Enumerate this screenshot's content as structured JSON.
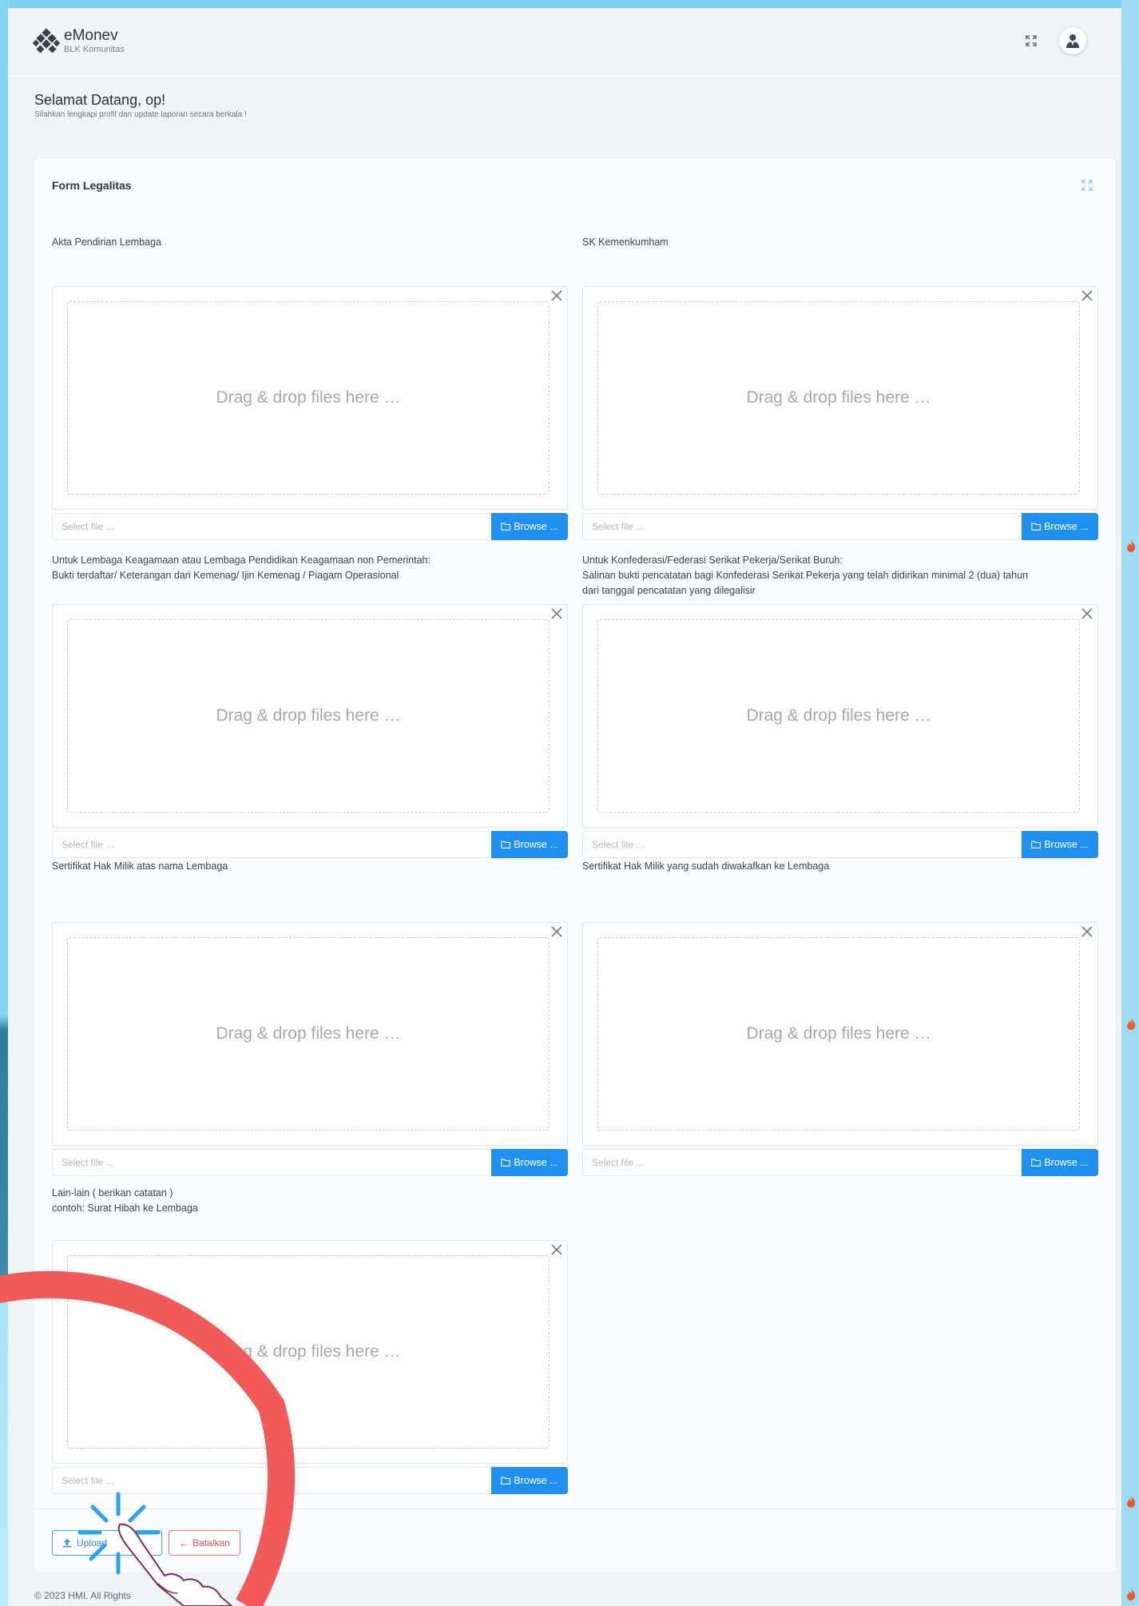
{
  "app": {
    "name": "eMonev",
    "subtitle": "BLK Komunitas"
  },
  "header": {
    "fullscreen_icon": "fullscreen-icon",
    "avatar_icon": "user-avatar-icon"
  },
  "welcome": {
    "title": "Selamat Datang, op!",
    "subtitle": "Silahkan lengkapi profil dan update laporan secara berkala !"
  },
  "form": {
    "title": "Form Legalitas",
    "dropzone_text": "Drag & drop files here …",
    "file_placeholder": "Select file ...",
    "browse_label": "Browse ...",
    "fields": [
      {
        "label_lines": [
          "Akta Pendirian Lembaga"
        ]
      },
      {
        "label_lines": [
          "SK Kemenkumham"
        ]
      },
      {
        "label_lines": [
          "Untuk Lembaga Keagamaan atau Lembaga Pendidikan Keagamaan non Pemerintah:",
          "Bukti terdaftar/ Keterangan dari Kemenag/ Ijin Kemenag / Piagam Operasional"
        ]
      },
      {
        "label_lines": [
          "Untuk Konfederasi/Federasi Serikat Pekerja/Serikat Buruh:",
          "Salinan bukti pencatatan bagi Konfederasi Serikat Pekerja yang telah didirikan minimal 2 (dua) tahun",
          "dari tanggal pencatatan yang dilegalisir"
        ]
      },
      {
        "label_lines": [
          "Sertifikat Hak Milik atas nama Lembaga"
        ]
      },
      {
        "label_lines": [
          "Sertifikat Hak Milik yang sudah diwakafkan ke Lembaga"
        ]
      },
      {
        "label_lines": [
          "Lain-lain ( berikan catatan )",
          "contoh: Surat Hibah ke Lembaga"
        ]
      }
    ],
    "upload_label": "Upload",
    "cancel_label": "Batalkan"
  },
  "footer": {
    "copyright": "© 2023 HMI. All Rights"
  },
  "colors": {
    "primary": "#1f8ff0",
    "danger": "#e8515c",
    "page_bg": "#eff4f6",
    "overlay_ring": "#f25a5a",
    "click_burst": "#2aa3f5"
  }
}
